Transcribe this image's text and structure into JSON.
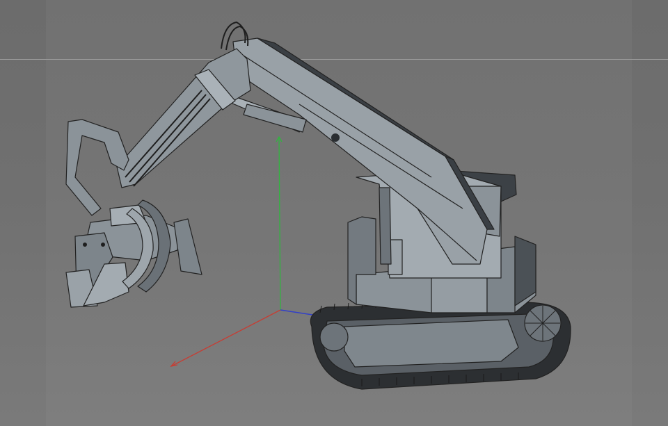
{
  "viewport": {
    "background_color": "#6f6f6f",
    "horizon_color": "#9a9a9a",
    "model_fill": "#8b9399",
    "model_dark_fill": "#3c4146",
    "wire_color": "#222222"
  },
  "axes": {
    "x_color": "#c83c32",
    "y_color": "#32b440",
    "z_color": "#3240c8"
  },
  "icons": {
    "axis_gizmo": "world-axis-icon"
  }
}
